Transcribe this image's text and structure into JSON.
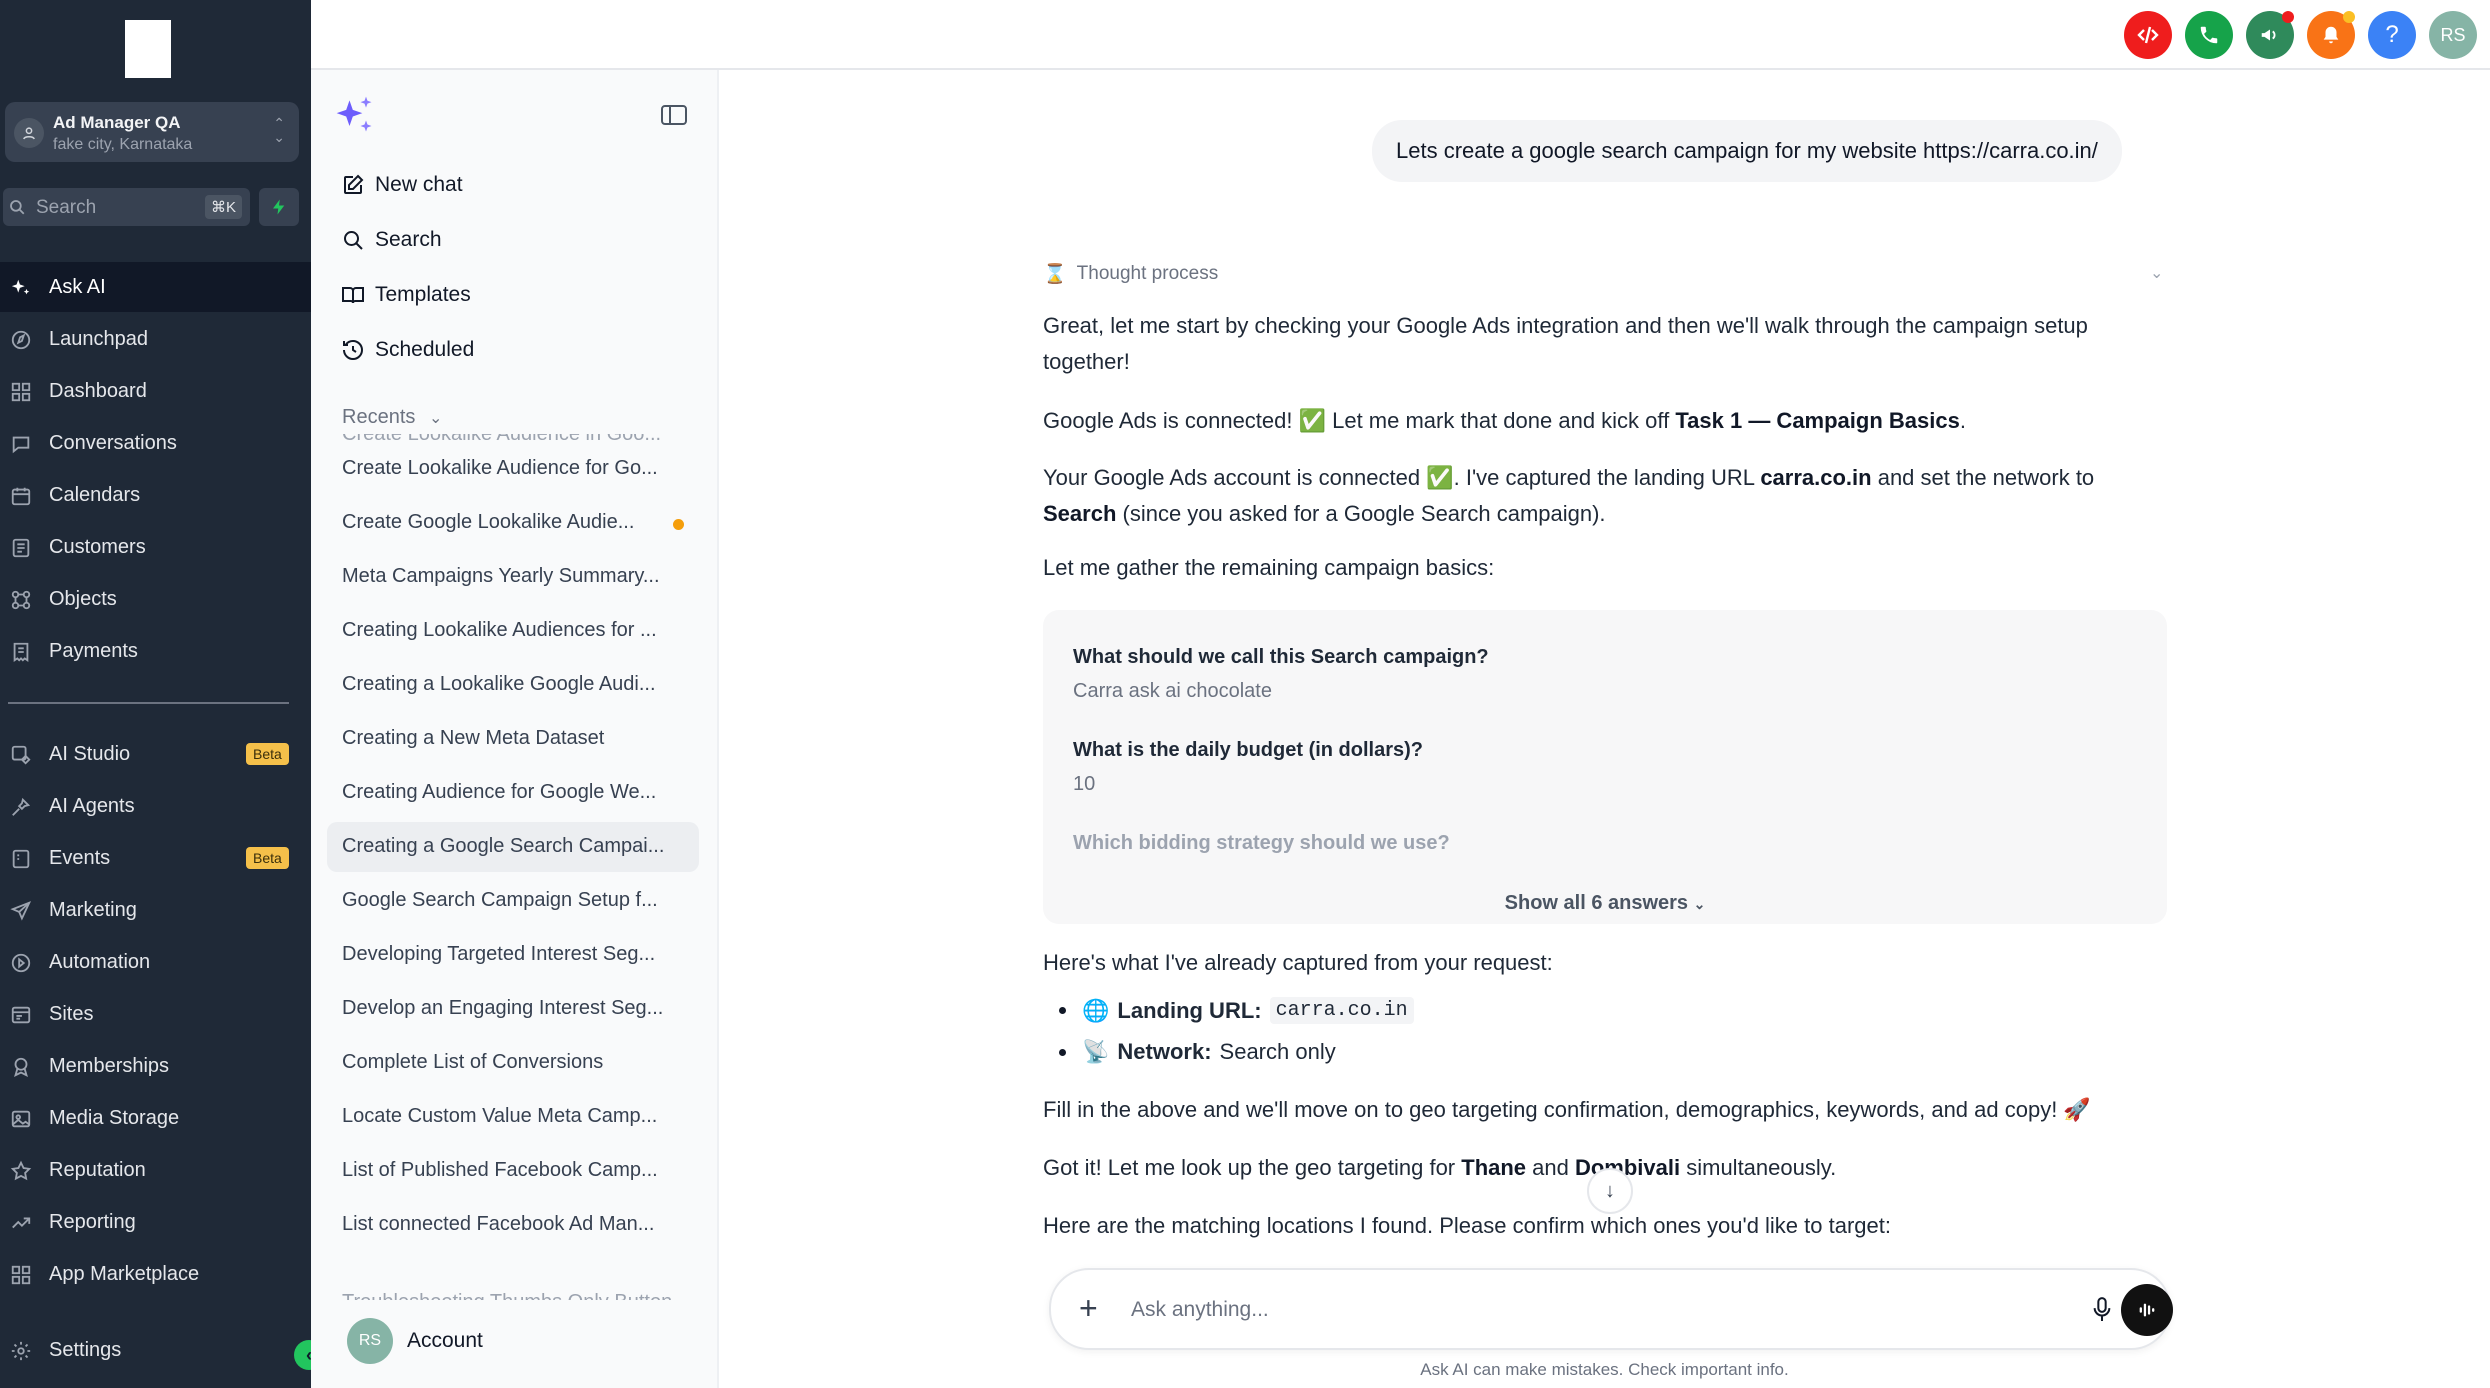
{
  "sidebar": {
    "account": {
      "name": "Ad Manager QA",
      "location": "fake city, Karnataka"
    },
    "search": {
      "placeholder": "Search",
      "shortcut": "⌘K"
    },
    "nav_primary": [
      {
        "label": "Ask AI",
        "icon": "sparkles-icon",
        "active": true
      },
      {
        "label": "Launchpad",
        "icon": "rocket-icon"
      },
      {
        "label": "Dashboard",
        "icon": "grid-icon"
      },
      {
        "label": "Conversations",
        "icon": "chat-bubble-icon"
      },
      {
        "label": "Calendars",
        "icon": "calendar-icon"
      },
      {
        "label": "Customers",
        "icon": "contacts-icon"
      },
      {
        "label": "Objects",
        "icon": "objects-icon"
      },
      {
        "label": "Payments",
        "icon": "receipt-icon"
      }
    ],
    "nav_secondary": [
      {
        "label": "AI Studio",
        "icon": "ai-studio-icon",
        "badge": "Beta"
      },
      {
        "label": "AI Agents",
        "icon": "agents-icon"
      },
      {
        "label": "Events",
        "icon": "events-icon",
        "badge": "Beta"
      },
      {
        "label": "Marketing",
        "icon": "send-icon"
      },
      {
        "label": "Automation",
        "icon": "automation-icon"
      },
      {
        "label": "Sites",
        "icon": "sites-icon"
      },
      {
        "label": "Memberships",
        "icon": "award-icon"
      },
      {
        "label": "Media Storage",
        "icon": "image-icon"
      },
      {
        "label": "Reputation",
        "icon": "star-icon"
      },
      {
        "label": "Reporting",
        "icon": "trend-icon"
      },
      {
        "label": "App Marketplace",
        "icon": "apps-icon"
      }
    ],
    "settings_label": "Settings"
  },
  "topbar": {
    "buttons": [
      {
        "name": "code-icon",
        "color": "#ef1d1d"
      },
      {
        "name": "phone-icon",
        "color": "#16a34a"
      },
      {
        "name": "megaphone-icon",
        "color": "#2f8a5b"
      },
      {
        "name": "bell-icon",
        "color": "#f97316"
      },
      {
        "name": "help-icon",
        "color": "#3b82f6"
      }
    ],
    "user_initials": "RS"
  },
  "chat_panel": {
    "actions": [
      {
        "label": "New chat",
        "icon": "edit-icon"
      },
      {
        "label": "Search",
        "icon": "search-icon"
      },
      {
        "label": "Templates",
        "icon": "book-icon"
      },
      {
        "label": "Scheduled",
        "icon": "clock-refresh-icon"
      }
    ],
    "recents_label": "Recents",
    "recents_cut_top": "Create Lookalike Audience in Goo...",
    "recents": [
      {
        "label": "Create Lookalike Audience for Go..."
      },
      {
        "label": "Create Google Lookalike Audie...",
        "dot": true
      },
      {
        "label": "Meta Campaigns Yearly Summary..."
      },
      {
        "label": "Creating Lookalike Audiences for ..."
      },
      {
        "label": "Creating a Lookalike Google Audi..."
      },
      {
        "label": "Creating a New Meta Dataset"
      },
      {
        "label": "Creating Audience for Google We..."
      },
      {
        "label": "Creating a Google Search Campai...",
        "selected": true
      },
      {
        "label": "Google Search Campaign Setup f..."
      },
      {
        "label": "Developing Targeted Interest Seg..."
      },
      {
        "label": "Develop an Engaging Interest Seg..."
      },
      {
        "label": "Complete List of Conversions"
      },
      {
        "label": "Locate Custom Value Meta Camp..."
      },
      {
        "label": "List of Published Facebook Camp..."
      },
      {
        "label": "List connected Facebook Ad Man..."
      }
    ],
    "recents_cut_bottom": "Troubleshooting Thumbs Only Button...",
    "account_initials": "RS",
    "account_label": "Account"
  },
  "conversation": {
    "user_message": "Lets create a google search campaign for my website https://carra.co.in/",
    "thought_label": "Thought process",
    "p1": "Great, let me start by checking your Google Ads integration and then we'll walk through the campaign setup together!",
    "p2_a": "Google Ads is connected! ✅ Let me mark that done and kick off ",
    "p2_b": "Task 1 — Campaign Basics",
    "p2_c": ".",
    "p3_a": "Your Google Ads account is connected ✅. I've captured the landing URL ",
    "p3_b": "carra.co.in",
    "p3_c": " and set the network to ",
    "p3_d": "Search",
    "p3_e": " (since you asked for a Google Search campaign).",
    "p4": "Let me gather the remaining campaign basics:",
    "qa": [
      {
        "q": "What should we call this Search campaign?",
        "a": "Carra ask ai chocolate"
      },
      {
        "q": "What is the daily budget (in dollars)?",
        "a": "10"
      }
    ],
    "qa_faded": "Which bidding strategy should we use?",
    "show_all": "Show all 6 answers",
    "p5": "Here's what I've already captured from your request:",
    "bullets": [
      {
        "emoji": "🌐",
        "label": "Landing URL:",
        "value": "carra.co.in",
        "code": true
      },
      {
        "emoji": "📡",
        "label": "Network:",
        "value": "Search only",
        "code": false
      }
    ],
    "p6": "Fill in the above and we'll move on to geo targeting confirmation, demographics, keywords, and ad copy! 🚀",
    "p7_a": "Got it! Let me look up the geo targeting for ",
    "p7_b": "Thane",
    "p7_c": " and ",
    "p7_d": "Dombivali",
    "p7_e": " simultaneously.",
    "p8": "Here are the matching locations I found. Please confirm which ones you'd like to target:"
  },
  "composer": {
    "placeholder": "Ask anything...",
    "disclaimer": "Ask AI can make mistakes. Check important info."
  }
}
